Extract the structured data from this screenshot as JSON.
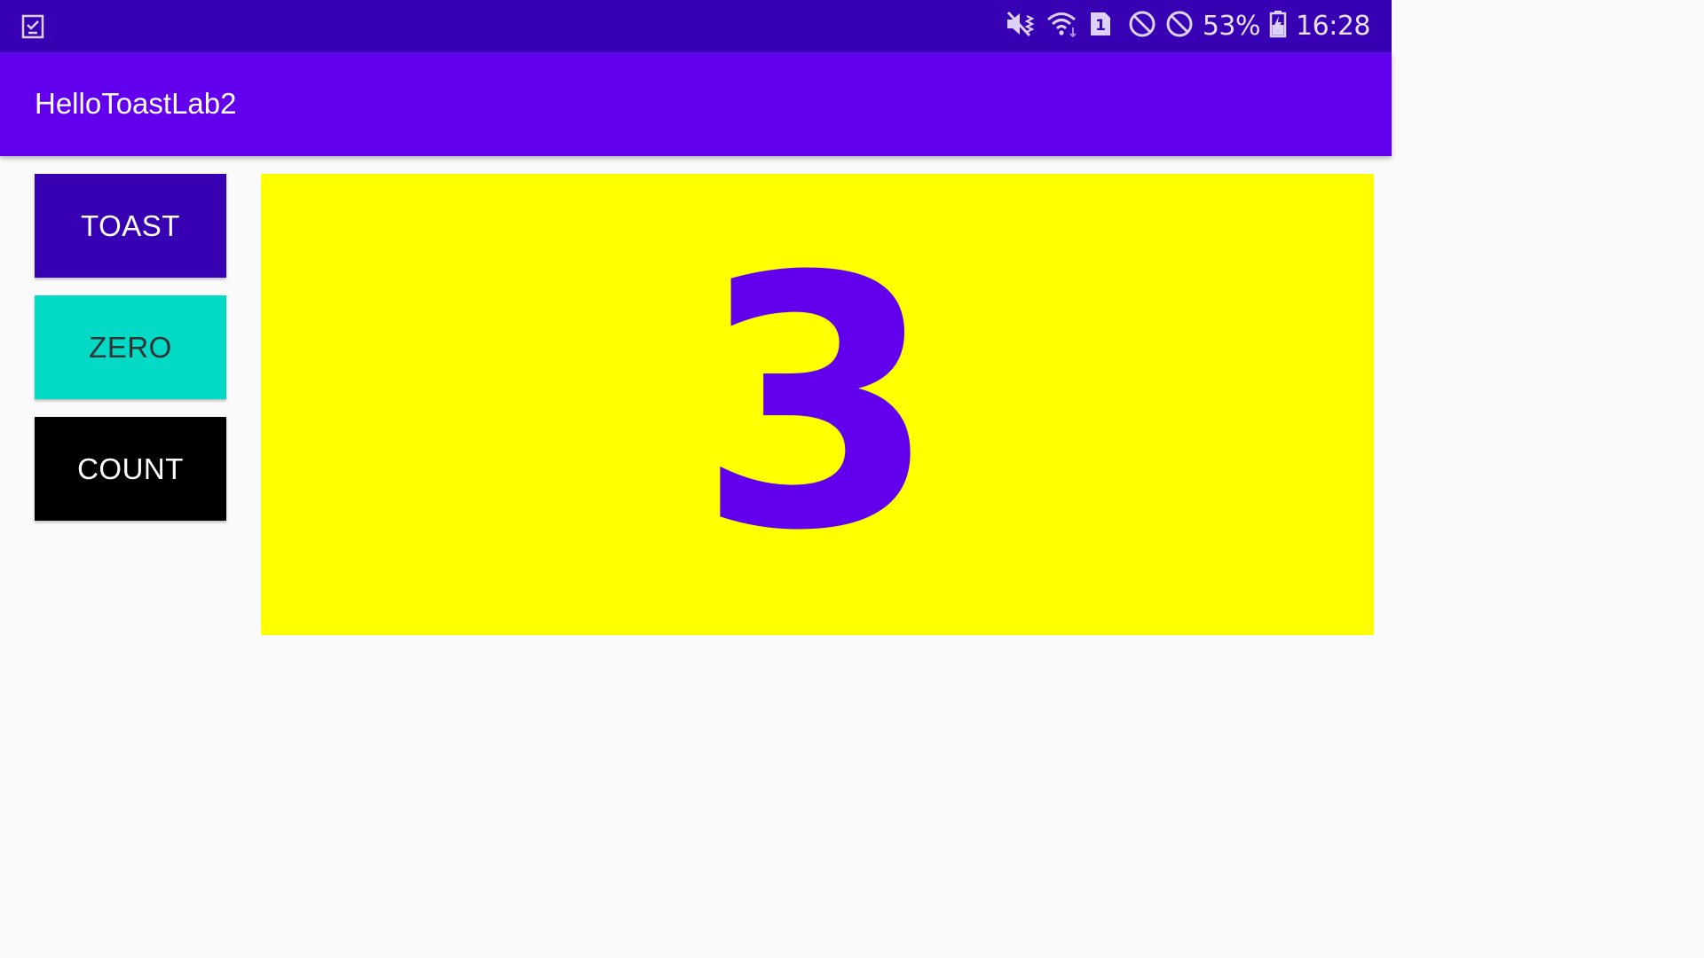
{
  "status_bar": {
    "battery": "53%",
    "time": "16:28",
    "sim_slot": "1",
    "icons": [
      "task-check-icon",
      "vibrate-mute-icon",
      "wifi-icon",
      "sim-card-icon",
      "block-icon",
      "block-icon",
      "battery-charging-icon"
    ]
  },
  "app_bar": {
    "title": "HelloToastLab2"
  },
  "buttons": {
    "toast": "TOAST",
    "zero": "ZERO",
    "count": "COUNT"
  },
  "counter": {
    "value": "3"
  },
  "colors": {
    "status_bar": "#3700b3",
    "app_bar": "#6200ee",
    "toast_button": "#3700b3",
    "zero_button": "#03dac5",
    "count_button": "#000000",
    "count_panel": "#ffff00",
    "count_text": "#6200ee"
  }
}
